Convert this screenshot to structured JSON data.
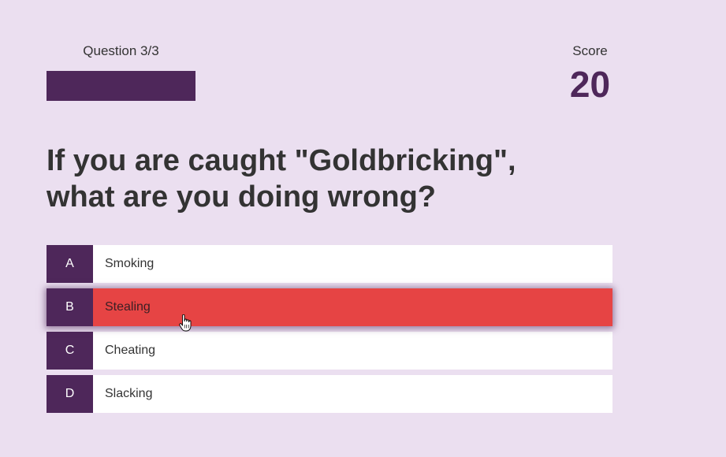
{
  "header": {
    "question_progress": "Question 3/3",
    "progress_fraction": 1.0,
    "score_label": "Score",
    "score_value": "20"
  },
  "question": {
    "line1": "If you are caught \"Goldbricking\",",
    "line2": "what are you doing wrong?"
  },
  "answers": [
    {
      "letter": "A",
      "text": "Smoking",
      "state": "default"
    },
    {
      "letter": "B",
      "text": "Stealing",
      "state": "wrong"
    },
    {
      "letter": "C",
      "text": "Cheating",
      "state": "default"
    },
    {
      "letter": "D",
      "text": "Slacking",
      "state": "default"
    }
  ],
  "colors": {
    "background": "#ebdff0",
    "accent": "#4e275a",
    "wrong": "#e64444",
    "answer_bg": "#ffffff"
  },
  "icons": {
    "cursor": "hand-pointer-icon"
  }
}
